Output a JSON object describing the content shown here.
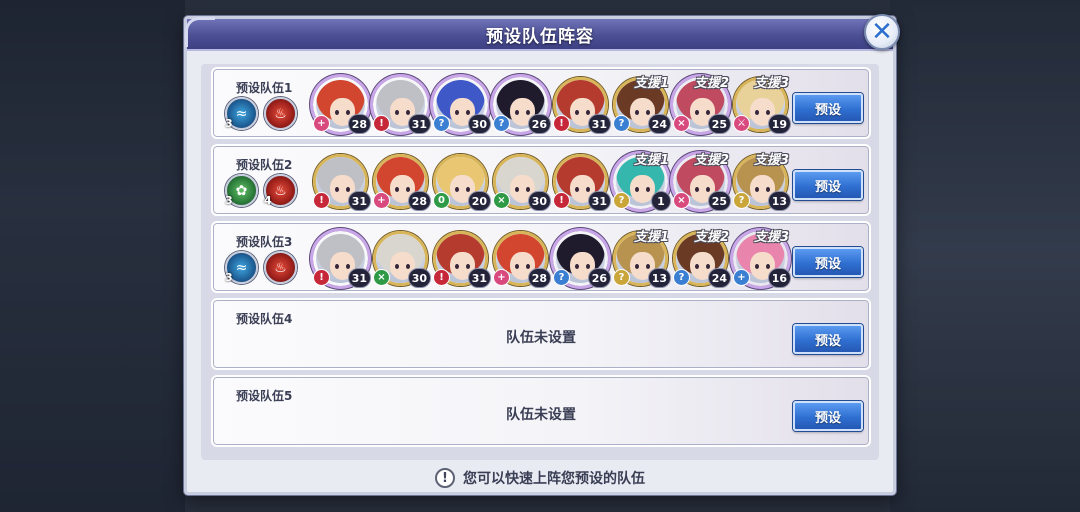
{
  "modal": {
    "title": "预设队伍阵容",
    "close_symbol": "✕"
  },
  "footer": {
    "tip": "您可以快速上阵您预设的队伍",
    "warn_symbol": "!"
  },
  "preset_button_label": "预设",
  "teams": [
    {
      "label": "预设队伍1",
      "elements": [
        {
          "type": "water",
          "count": "3"
        },
        {
          "type": "fire",
          "count": ""
        }
      ],
      "members": [
        {
          "level": "28",
          "class": "pink",
          "class_glyph": "+",
          "frame": "rainbow",
          "hair": "#d2452f",
          "support": ""
        },
        {
          "level": "31",
          "class": "red",
          "class_glyph": "!",
          "frame": "rainbow",
          "hair": "#bfbfc6",
          "support": ""
        },
        {
          "level": "30",
          "class": "blue",
          "class_glyph": "?",
          "frame": "rainbow",
          "hair": "#3f58c7",
          "support": ""
        },
        {
          "level": "26",
          "class": "blue",
          "class_glyph": "?",
          "frame": "rainbow",
          "hair": "#1f1a2c",
          "support": ""
        },
        {
          "level": "31",
          "class": "red",
          "class_glyph": "!",
          "frame": "gold",
          "hair": "#b43b2d",
          "support": ""
        },
        {
          "level": "24",
          "class": "blue",
          "class_glyph": "?",
          "frame": "gold",
          "hair": "#6b3a24",
          "support": "支援1"
        },
        {
          "level": "25",
          "class": "pink",
          "class_glyph": "×",
          "frame": "rainbow",
          "hair": "#c04a5f",
          "support": "支援2"
        },
        {
          "level": "19",
          "class": "pink",
          "class_glyph": "⚔",
          "frame": "gold",
          "hair": "#e8d29a",
          "support": "支援3"
        }
      ]
    },
    {
      "label": "预设队伍2",
      "elements": [
        {
          "type": "wind",
          "count": "3"
        },
        {
          "type": "fire",
          "count": "4"
        }
      ],
      "members": [
        {
          "level": "31",
          "class": "red",
          "class_glyph": "!",
          "frame": "gold",
          "hair": "#bfbfc6",
          "support": ""
        },
        {
          "level": "28",
          "class": "pink",
          "class_glyph": "+",
          "frame": "gold",
          "hair": "#d2452f",
          "support": ""
        },
        {
          "level": "20",
          "class": "green",
          "class_glyph": "0",
          "frame": "gold",
          "hair": "#e9c772",
          "support": ""
        },
        {
          "level": "30",
          "class": "green",
          "class_glyph": "×",
          "frame": "gold",
          "hair": "#d9d6cf",
          "support": ""
        },
        {
          "level": "31",
          "class": "red",
          "class_glyph": "!",
          "frame": "gold",
          "hair": "#b43b2d",
          "support": ""
        },
        {
          "level": "1",
          "class": "gold",
          "class_glyph": "?",
          "frame": "rainbow",
          "hair": "#35b7ae",
          "support": "支援1"
        },
        {
          "level": "25",
          "class": "pink",
          "class_glyph": "×",
          "frame": "rainbow",
          "hair": "#c04a5f",
          "support": "支援2"
        },
        {
          "level": "13",
          "class": "gold",
          "class_glyph": "?",
          "frame": "gold",
          "hair": "#b8924f",
          "support": "支援3"
        }
      ]
    },
    {
      "label": "预设队伍3",
      "elements": [
        {
          "type": "water",
          "count": "3"
        },
        {
          "type": "fire",
          "count": ""
        }
      ],
      "members": [
        {
          "level": "31",
          "class": "red",
          "class_glyph": "!",
          "frame": "rainbow",
          "hair": "#bfbfc6",
          "support": ""
        },
        {
          "level": "30",
          "class": "green",
          "class_glyph": "×",
          "frame": "gold",
          "hair": "#d9d6cf",
          "support": ""
        },
        {
          "level": "31",
          "class": "red",
          "class_glyph": "!",
          "frame": "gold",
          "hair": "#b43b2d",
          "support": ""
        },
        {
          "level": "28",
          "class": "pink",
          "class_glyph": "+",
          "frame": "gold",
          "hair": "#d2452f",
          "support": ""
        },
        {
          "level": "26",
          "class": "blue",
          "class_glyph": "?",
          "frame": "rainbow",
          "hair": "#1f1a2c",
          "support": ""
        },
        {
          "level": "13",
          "class": "gold",
          "class_glyph": "?",
          "frame": "gold",
          "hair": "#b8924f",
          "support": "支援1"
        },
        {
          "level": "24",
          "class": "blue",
          "class_glyph": "?",
          "frame": "gold",
          "hair": "#6b3a24",
          "support": "支援2"
        },
        {
          "level": "16",
          "class": "blue",
          "class_glyph": "+",
          "frame": "rainbow",
          "hair": "#e985ad",
          "support": "支援3"
        }
      ]
    },
    {
      "label": "预设队伍4",
      "empty_text": "队伍未设置",
      "elements": [],
      "members": []
    },
    {
      "label": "预设队伍5",
      "empty_text": "队伍未设置",
      "elements": [],
      "members": []
    }
  ],
  "colors": {
    "header": "#4c4f93",
    "button": "#2f6fd1",
    "panel": "#e9ebf2"
  }
}
